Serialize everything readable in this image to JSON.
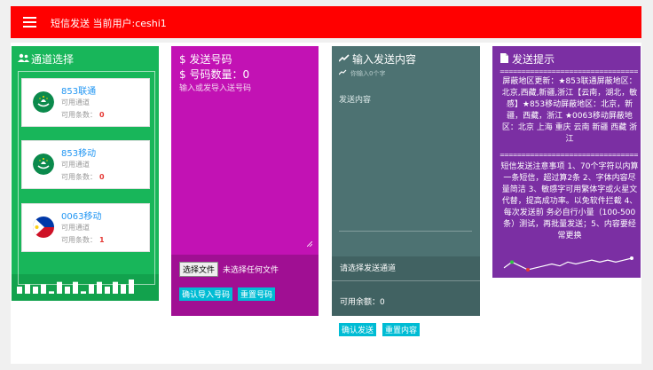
{
  "header": {
    "title": "短信发送 当前用户:ceshi1"
  },
  "channel_panel": {
    "title": "通道选择",
    "cards": [
      {
        "name": "853联通",
        "status": "可用通道",
        "count_label": "可用条数：",
        "count": "0",
        "flag": "macau-flag-icon"
      },
      {
        "name": "853移动",
        "status": "可用通道",
        "count_label": "可用条数：",
        "count": "0",
        "flag": "macau-flag-icon"
      },
      {
        "name": "0063移动",
        "status": "可用通道",
        "count_label": "可用条数：",
        "count": "1",
        "flag": "philippines-flag-icon"
      }
    ],
    "bar_values": [
      3,
      4,
      3,
      4,
      1,
      5,
      3,
      5,
      1,
      4,
      5,
      3,
      5,
      4,
      6
    ],
    "colors": {
      "panel": "#18b65a",
      "bottom": "#12a24d"
    }
  },
  "number_panel": {
    "title": "$ 发送号码",
    "count_title": "$ 号码数量：0",
    "placeholder": "输入或发导入送号码",
    "file_button": "选择文件",
    "file_text": "未选择任何文件",
    "import_button": "确认导入号码",
    "reset_button": "重置号码",
    "footer_mark": "\\",
    "colors": {
      "panel": "#c212b4",
      "lower": "#a00f93"
    }
  },
  "content_panel": {
    "title": "输入发送内容",
    "subtitle": "你输入0个字",
    "placeholder": "发送内容",
    "channel_prompt": "请选择发送通道",
    "balance_text": "可用余额：0",
    "send_button": "确认发送",
    "reset_button": "重置内容",
    "colors": {
      "panel": "#4d7272",
      "lower": "#416262"
    }
  },
  "tips_panel": {
    "title": "发送提示",
    "separator": "================================",
    "blocked_text": "屏蔽地区更新：★853联通屏蔽地区：北京,西藏,新疆,浙江【云南，湖北，敏感】★853移动屏蔽地区：北京，新疆，西藏，浙江 ★0063移动屏蔽地区：北京 上海 重庆 云南 新疆 西藏 浙江",
    "notes_text": "短信发送注意事项 1、70个字符以内算一条短信，超过算2条 2、字体内容尽量简洁 3、敏感字可用繁体字或火星文代替，提高成功率。以免软件拦截 4、每次发送前 务必自行小量（100-500条）测试，再批量发送；5、内容要经常更换",
    "sparkline": [
      3,
      6,
      4,
      2,
      3,
      4,
      5,
      4,
      6,
      5,
      6,
      7,
      6,
      7,
      6,
      7,
      8
    ],
    "colors": {
      "panel": "#7b2fa3",
      "dot_green": "#2ecc40",
      "dot_red": "#e53935"
    }
  },
  "colors": {
    "header": "#ff0000",
    "button": "#00bcd4"
  }
}
